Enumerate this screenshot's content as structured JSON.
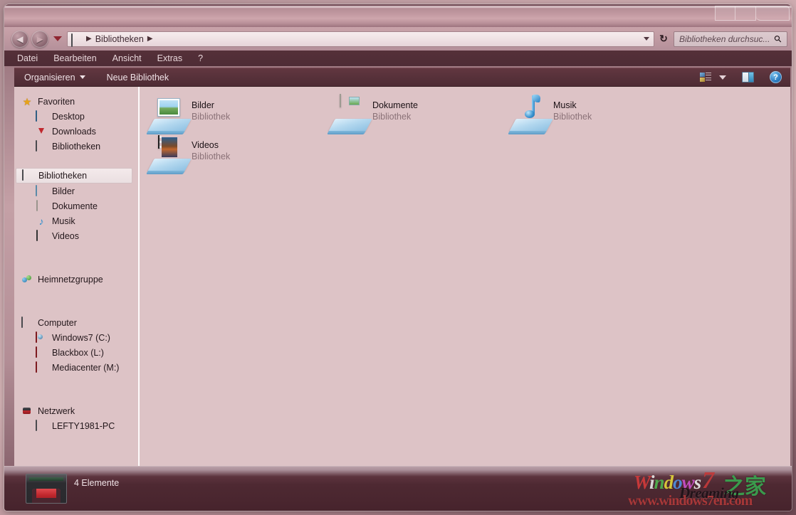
{
  "window": {
    "buttons": [
      {
        "name": "minimize",
        "glyph": ""
      },
      {
        "name": "maximize",
        "glyph": ""
      },
      {
        "name": "close",
        "glyph": ""
      }
    ]
  },
  "address": {
    "back_glyph": "◀",
    "forward_glyph": "▶",
    "crumb_icon": "library-icon",
    "crumb": "Bibliotheken",
    "sep": "▶",
    "refresh_glyph": "↻",
    "dropdown_glyph": "▼"
  },
  "search": {
    "placeholder": "Bibliotheken durchsuc...",
    "icon": "search-icon"
  },
  "menubar": {
    "items": [
      {
        "label": "Datei"
      },
      {
        "label": "Bearbeiten"
      },
      {
        "label": "Ansicht"
      },
      {
        "label": "Extras"
      },
      {
        "label": "?"
      }
    ]
  },
  "toolbar": {
    "organize_label": "Organisieren",
    "new_library_label": "Neue Bibliothek",
    "view_icon": "view-options-icon",
    "preview_icon": "preview-pane-icon",
    "help_icon": "help-icon",
    "help_glyph": "?"
  },
  "sidebar": {
    "groups": [
      {
        "header": {
          "label": "Favoriten",
          "icon": "star-icon"
        },
        "items": [
          {
            "label": "Desktop",
            "icon": "desktop-icon"
          },
          {
            "label": "Downloads",
            "icon": "downloads-icon"
          },
          {
            "label": "Bibliotheken",
            "icon": "library-icon"
          }
        ]
      },
      {
        "header": {
          "label": "Bibliotheken",
          "icon": "library-icon",
          "selected": true
        },
        "items": [
          {
            "label": "Bilder",
            "icon": "pictures-icon"
          },
          {
            "label": "Dokumente",
            "icon": "documents-icon"
          },
          {
            "label": "Musik",
            "icon": "music-icon"
          },
          {
            "label": "Videos",
            "icon": "videos-icon"
          }
        ]
      },
      {
        "header": {
          "label": "Heimnetzgruppe",
          "icon": "homegroup-icon"
        },
        "items": []
      },
      {
        "header": {
          "label": "Computer",
          "icon": "computer-icon"
        },
        "items": [
          {
            "label": "Windows7 (C:)",
            "icon": "system-drive-icon"
          },
          {
            "label": "Blackbox (L:)",
            "icon": "drive-icon"
          },
          {
            "label": "Mediacenter (M:)",
            "icon": "drive-icon"
          }
        ]
      },
      {
        "header": {
          "label": "Netzwerk",
          "icon": "network-icon"
        },
        "items": [
          {
            "label": "LEFTY1981-PC",
            "icon": "computer-icon"
          }
        ]
      }
    ]
  },
  "main": {
    "items": [
      {
        "name": "Bilder",
        "sub": "Bibliothek",
        "icon": "pictures-library-icon",
        "col": 0,
        "row": 0
      },
      {
        "name": "Dokumente",
        "sub": "Bibliothek",
        "icon": "documents-library-icon",
        "col": 1,
        "row": 0
      },
      {
        "name": "Musik",
        "sub": "Bibliothek",
        "icon": "music-library-icon",
        "col": 2,
        "row": 0
      },
      {
        "name": "Videos",
        "sub": "Bibliothek",
        "icon": "videos-library-icon",
        "col": 0,
        "row": 1
      }
    ]
  },
  "statusbar": {
    "item_count_text": "4 Elemente",
    "icon": "library-icon"
  },
  "watermark": {
    "brand_letters": [
      "W",
      "i",
      "n",
      "d",
      "o",
      "w",
      "s"
    ],
    "seven": "7",
    "cjk": "之家",
    "dreaming": "Dreaming",
    "url": "www.windows7en.com"
  },
  "colors": {
    "content_bg": "#ddc3c6",
    "titlebar": "#c39aa2",
    "menubar": "#4e2c35",
    "toolbar": "#57313a",
    "statusbar": "#4a262f",
    "accent_red": "#c0272d",
    "text_dark": "#1b1115",
    "text_muted": "#8b7278"
  }
}
